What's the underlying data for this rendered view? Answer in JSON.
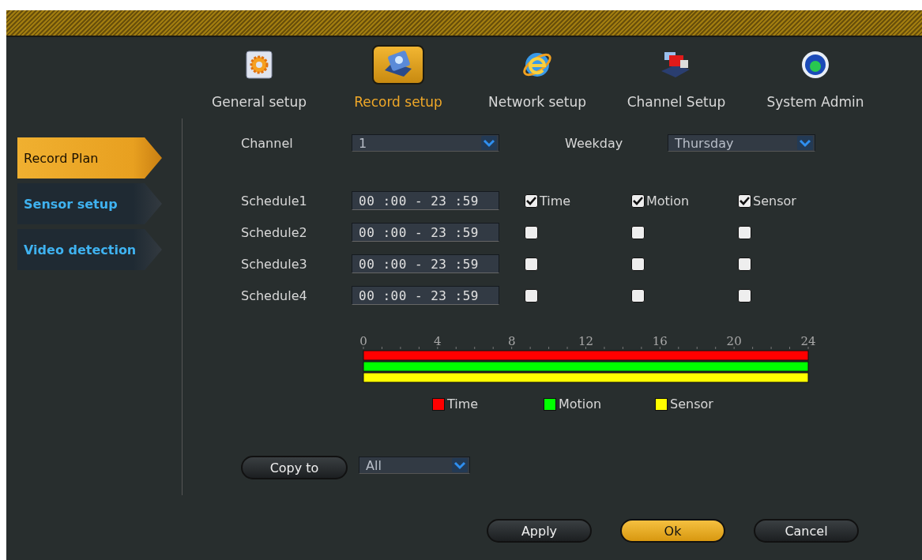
{
  "nav_tabs": [
    {
      "label": "General setup",
      "kind": "gear",
      "selected": false
    },
    {
      "label": "Record setup",
      "kind": "record",
      "selected": true
    },
    {
      "label": "Network setup",
      "kind": "globe",
      "selected": false
    },
    {
      "label": "Channel Setup",
      "kind": "channel",
      "selected": false
    },
    {
      "label": "System Admin",
      "kind": "admin",
      "selected": false
    }
  ],
  "sidebar": {
    "items": [
      {
        "label": "Record Plan",
        "selected": true
      },
      {
        "label": "Sensor setup",
        "selected": false
      },
      {
        "label": "Video detection",
        "selected": false
      }
    ]
  },
  "channel": {
    "label": "Channel",
    "value": "1"
  },
  "weekday": {
    "label": "Weekday",
    "value": "Thursday"
  },
  "schedules": [
    {
      "label": "Schedule1",
      "time": "00 :00 - 23 :59",
      "checks": [
        {
          "label": "Time",
          "checked": true
        },
        {
          "label": "Motion",
          "checked": true
        },
        {
          "label": "Sensor",
          "checked": true
        }
      ]
    },
    {
      "label": "Schedule2",
      "time": "00 :00 - 23 :59",
      "checks": [
        {
          "checked": false
        },
        {
          "checked": false
        },
        {
          "checked": false
        }
      ]
    },
    {
      "label": "Schedule3",
      "time": "00 :00 - 23 :59",
      "checks": [
        {
          "checked": false
        },
        {
          "checked": false
        },
        {
          "checked": false
        }
      ]
    },
    {
      "label": "Schedule4",
      "time": "00 :00 - 23 :59",
      "checks": [
        {
          "checked": false
        },
        {
          "checked": false
        },
        {
          "checked": false
        }
      ]
    }
  ],
  "chart_data": {
    "type": "bar",
    "orientation": "horizontal",
    "xlim": [
      0,
      24
    ],
    "xticks": [
      0,
      4,
      8,
      12,
      16,
      20,
      24
    ],
    "series": [
      {
        "name": "Time",
        "color": "#ff0000",
        "values": [
          24
        ]
      },
      {
        "name": "Motion",
        "color": "#00ff00",
        "values": [
          24
        ]
      },
      {
        "name": "Sensor",
        "color": "#ffff00",
        "values": [
          24
        ]
      }
    ]
  },
  "copy": {
    "button": "Copy to",
    "value": "All"
  },
  "buttons": [
    {
      "label": "Apply",
      "primary": false
    },
    {
      "label": "Ok",
      "primary": true
    },
    {
      "label": "Cancel",
      "primary": false
    }
  ]
}
